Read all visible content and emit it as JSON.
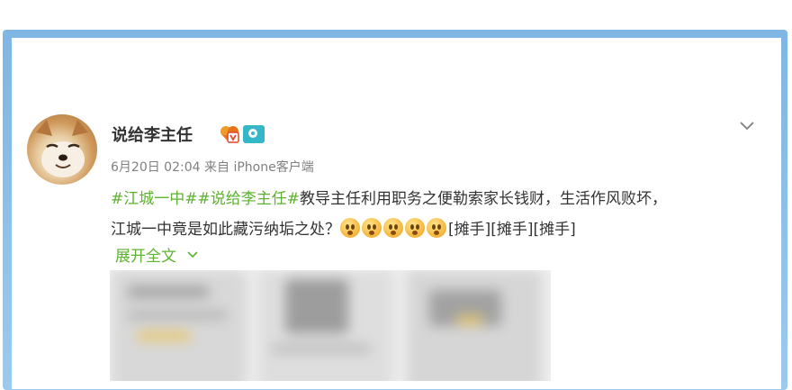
{
  "post": {
    "username": "说给李主任",
    "badges": [
      "vip-icon",
      "camera-icon"
    ],
    "time": "6月20日 02:04",
    "source_prefix": "来自",
    "source": "iPhone客户端",
    "content": {
      "topic1": "#江城一中#",
      "topic2": "#说给李主任#",
      "text1": "教导主任利用职务之便勒索家长钱财，生活作风败坏，",
      "text2": "江城一中竟是如此藏污纳垢之处？",
      "emoji_count": 5,
      "tags": "[摊手][摊手][摊手]"
    },
    "expand_label": "展开全文"
  },
  "colors": {
    "frame": "#8cc0ea",
    "topic": "#5eb22f",
    "text": "#333333",
    "meta": "#808080"
  }
}
